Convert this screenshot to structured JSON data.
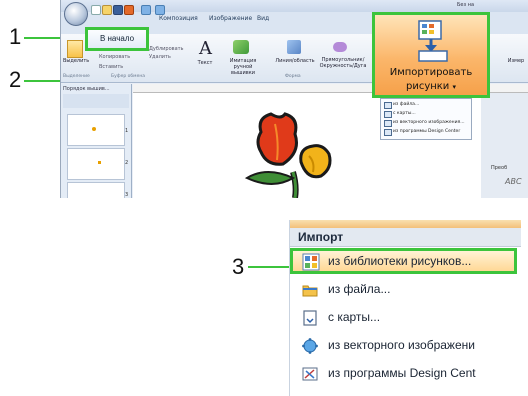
{
  "callouts": {
    "one": "1",
    "two": "2",
    "three": "3"
  },
  "app": {
    "title_text": "Без на",
    "tabs": [
      "Композиция",
      "Изображение",
      "Вид"
    ],
    "home_tab": "В начало",
    "ribbon": {
      "select": "Выделить",
      "copy": "Копировать",
      "duplicate": "Дублировать",
      "delete": "Удалить",
      "paste": "Вставить",
      "text": "Текст",
      "hand_embroidery_imitation": "Имитация ручной вышивки",
      "line_area": "Линия/область",
      "rect_circle": "Прямоугольник/ Окружность/Дуга",
      "edit": "Измер",
      "group_select": "Выделение",
      "group_clipboard": "Буфер обмена",
      "group_shape": "Форма"
    },
    "import_button": {
      "line1": "Импортировать",
      "line2": "рисунки"
    },
    "mini_menu": [
      "из файла...",
      "с карты...",
      "из векторного изображения...",
      "из программы Design Center"
    ],
    "left_panel_title": "Порядок вышив...",
    "thumb_numbers": [
      "1",
      "2",
      "3"
    ],
    "right_panel_label": "Преоб",
    "right_panel_sample": "ABC"
  },
  "import_menu": {
    "header": "Импорт",
    "items": [
      {
        "label": "из библиотеки рисунков...",
        "icon": "library-icon",
        "selected": true
      },
      {
        "label": "из файла...",
        "icon": "folder-icon",
        "selected": false
      },
      {
        "label": "с карты...",
        "icon": "card-icon",
        "selected": false
      },
      {
        "label": "из векторного изображени",
        "icon": "vector-icon",
        "selected": false
      },
      {
        "label": "из программы Design Cent",
        "icon": "design-center-icon",
        "selected": false
      }
    ]
  },
  "colors": {
    "highlight": "#3cc43c",
    "import_orange": "#f6a14a"
  }
}
